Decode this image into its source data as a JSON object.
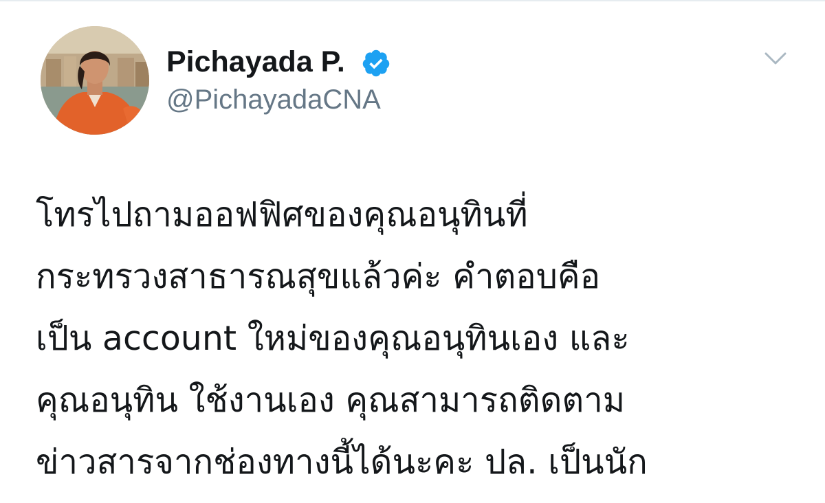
{
  "tweet": {
    "author": {
      "display_name": "Pichayada P.",
      "handle": "@PichayadaCNA",
      "verified": true,
      "avatar_icon": "profile-photo"
    },
    "menu_icon": "chevron-down-icon",
    "lines": [
      "โทรไปถามออฟฟิศของคุณอนุทินที่",
      "กระทรวงสาธารณสุขแล้วค่ะ คำตอบคือ",
      "เป็น account  ใหม่ของคุณอนุทินเอง และ",
      "คุณอนุทิน ใช้งานเอง คุณสามารถติดตาม",
      "ข่าวสารจากช่องทางนี้ได้นะคะ ปล. เป็นนัก"
    ]
  },
  "colors": {
    "text_primary": "#14171a",
    "text_secondary": "#657786",
    "verified_blue": "#1da1f2",
    "caret_gray": "#aab8c2"
  }
}
